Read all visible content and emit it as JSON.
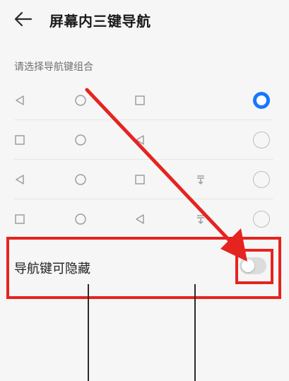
{
  "header": {
    "back_icon": "arrow-left-icon",
    "title": "屏幕内三键导航"
  },
  "section": {
    "label": "请选择导航键组合"
  },
  "options": [
    {
      "icons": [
        "triangle-back-icon",
        "circle-home-icon",
        "square-recent-icon"
      ],
      "selected": true
    },
    {
      "icons": [
        "square-recent-icon",
        "circle-home-icon",
        "triangle-back-icon"
      ],
      "selected": false
    },
    {
      "icons": [
        "triangle-back-icon",
        "circle-home-icon",
        "square-recent-icon",
        "notification-pull-icon"
      ],
      "selected": false
    },
    {
      "icons": [
        "square-recent-icon",
        "circle-home-icon",
        "triangle-back-icon",
        "notification-pull-icon"
      ],
      "selected": false
    }
  ],
  "toggle": {
    "label": "导航键可隐藏",
    "on": false
  },
  "annotation": {
    "color": "#e52420"
  },
  "colors": {
    "accent": "#1677ff",
    "background": "#f6f6f6",
    "icon": "#9e9e9e"
  }
}
